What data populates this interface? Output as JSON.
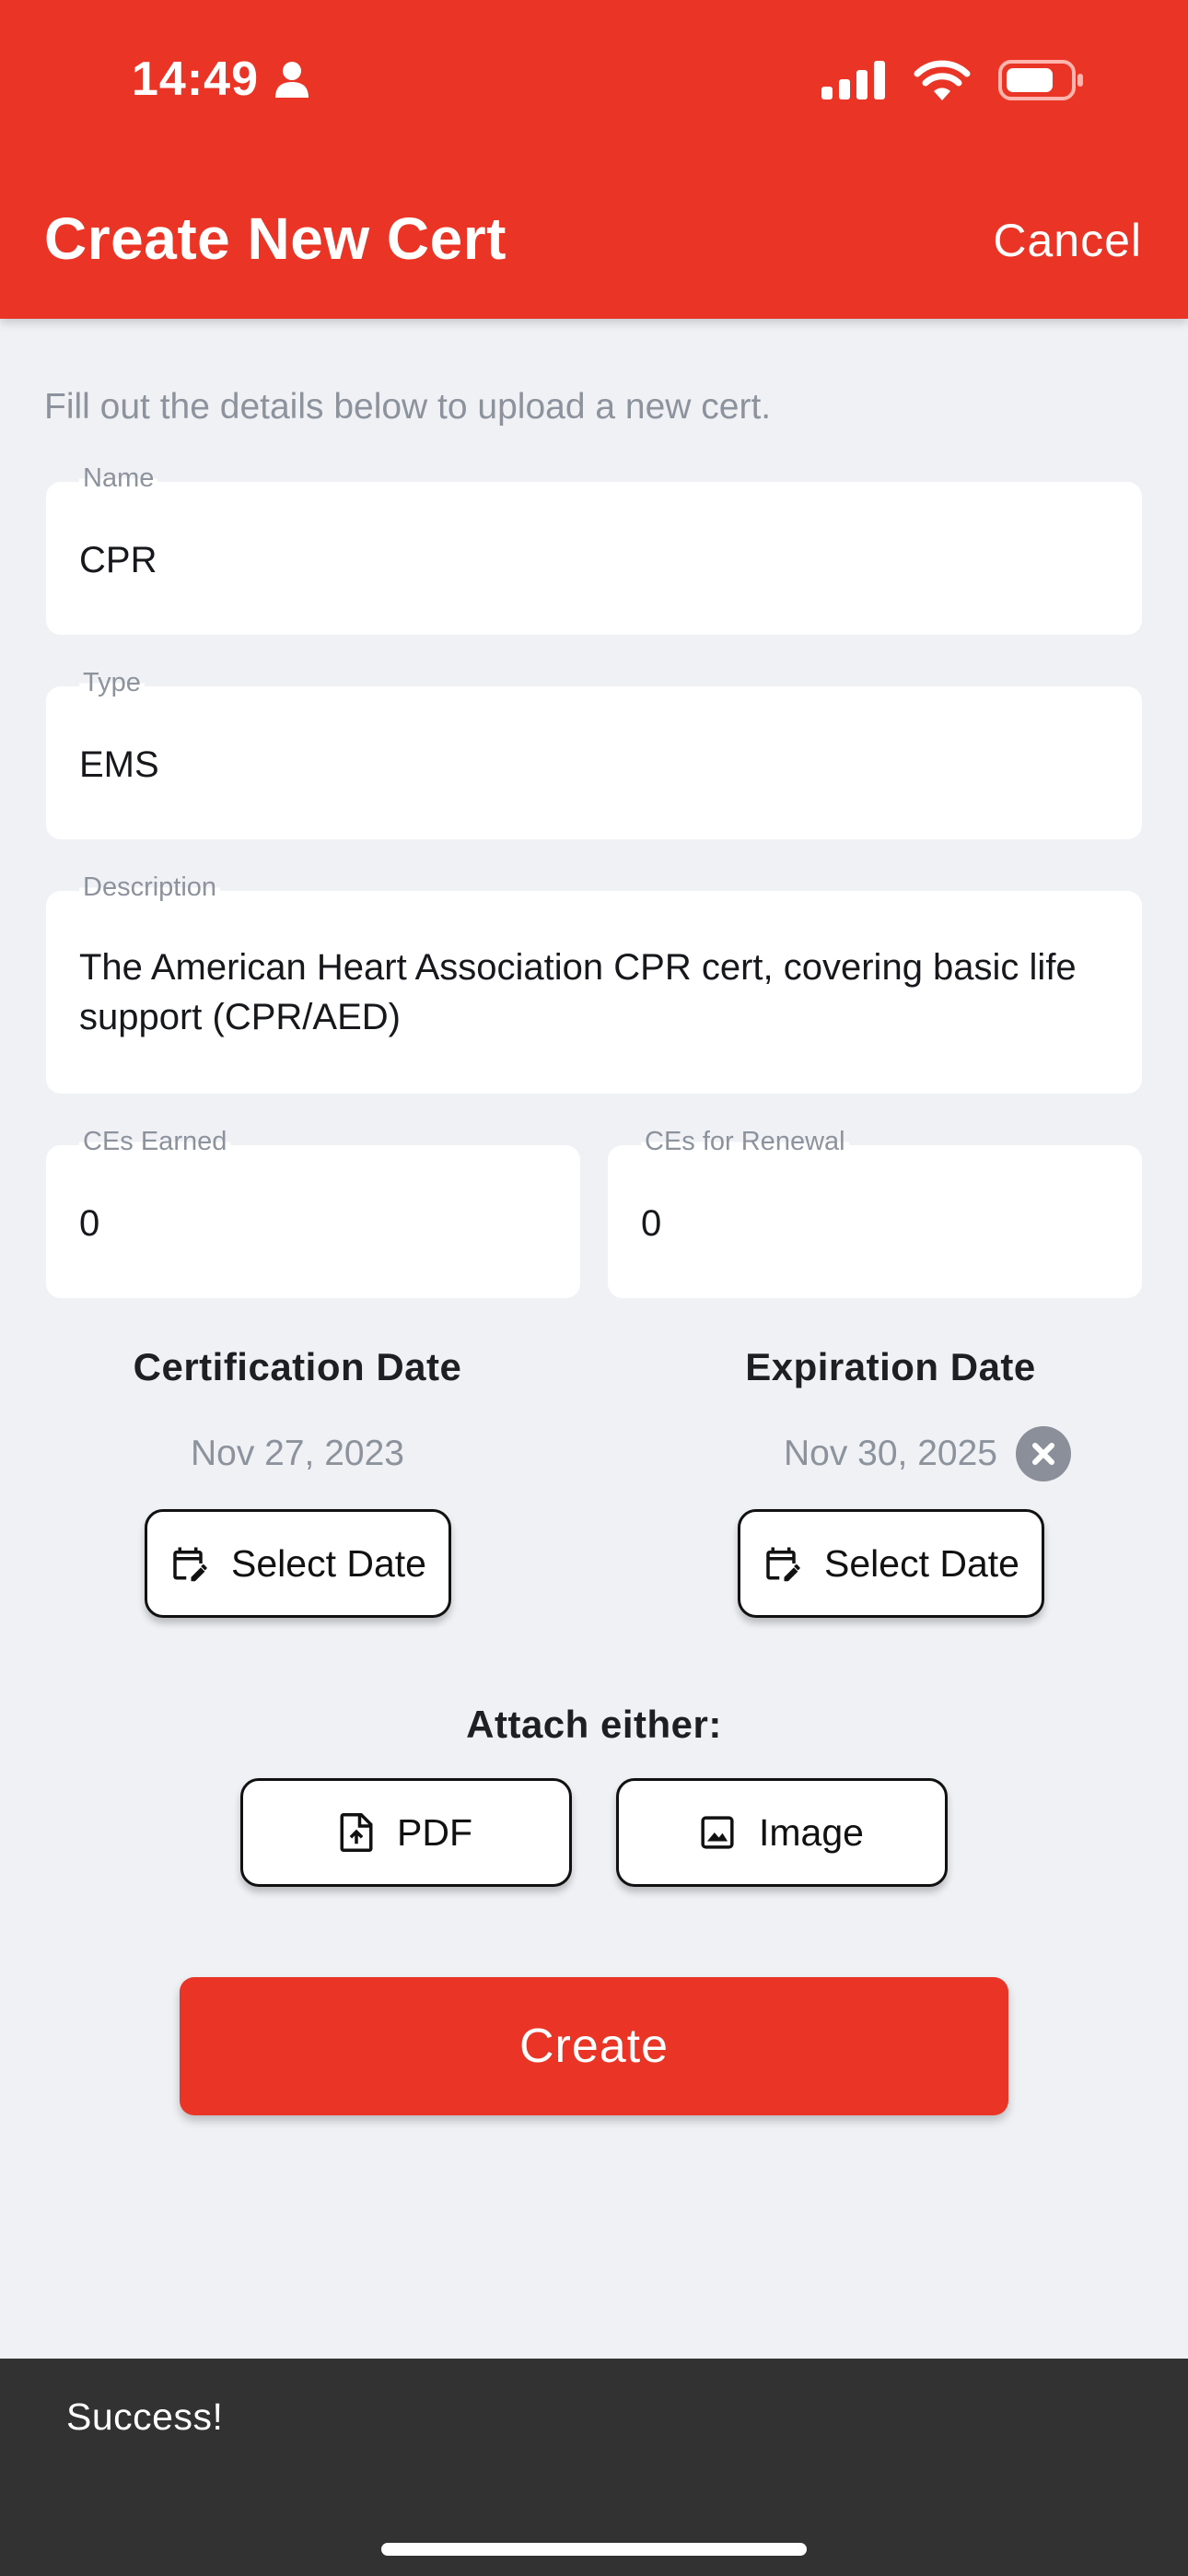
{
  "status_bar": {
    "time": "14:49"
  },
  "header": {
    "title": "Create New Cert",
    "cancel_label": "Cancel"
  },
  "intro": "Fill out the details below to upload a new cert.",
  "fields": {
    "name": {
      "label": "Name",
      "value": "CPR"
    },
    "type": {
      "label": "Type",
      "value": "EMS"
    },
    "description": {
      "label": "Description",
      "value": "The American Heart Association CPR cert, covering basic life support (CPR/AED)"
    },
    "ces_earned": {
      "label": "CEs Earned",
      "value": "0"
    },
    "ces_renewal": {
      "label": "CEs for Renewal",
      "value": "0"
    }
  },
  "certification_date": {
    "heading": "Certification Date",
    "value": "Nov 27, 2023",
    "button_label": "Select Date"
  },
  "expiration_date": {
    "heading": "Expiration Date",
    "value": "Nov 30, 2025",
    "button_label": "Select Date"
  },
  "attach": {
    "label": "Attach either:",
    "pdf_label": "PDF",
    "image_label": "Image"
  },
  "create_label": "Create",
  "snackbar": {
    "message": "Success!"
  },
  "colors": {
    "brand": "#ea3425",
    "background": "#eff1f5",
    "snackbar": "#323232"
  }
}
